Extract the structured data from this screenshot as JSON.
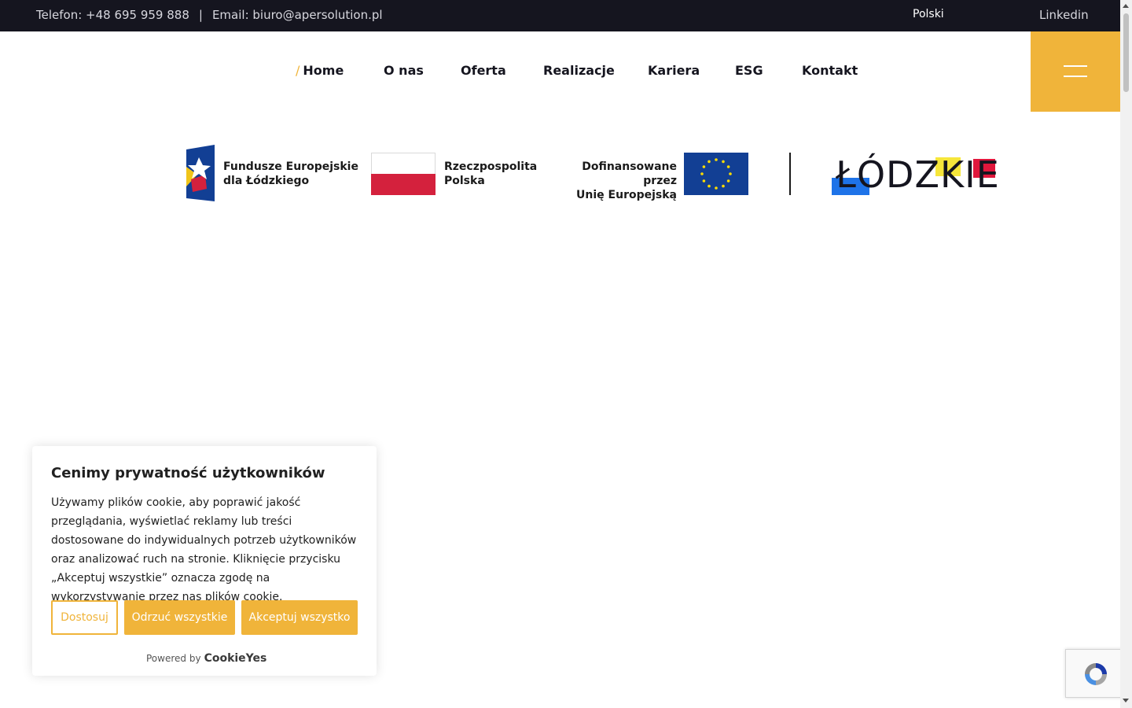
{
  "topbar": {
    "phone": "Telefon: +48 695 959 888",
    "separator": "|",
    "email": "Email: biuro@apersolution.pl",
    "language": "Polski",
    "linkedin": "Linkedin"
  },
  "nav": {
    "active_marker": "/",
    "items": [
      {
        "label": "Home"
      },
      {
        "label": "O nas"
      },
      {
        "label": "Oferta"
      },
      {
        "label": "Realizacje"
      },
      {
        "label": "Kariera"
      },
      {
        "label": "ESG"
      },
      {
        "label": "Kontakt"
      }
    ],
    "menu_icon": "hamburger-icon"
  },
  "funding": {
    "fe_line1": "Fundusze Europejskie",
    "fe_line2": "dla Łódzkiego",
    "rp_line1": "Rzeczpospolita",
    "rp_line2": "Polska",
    "ue_line1": "Dofinansowane przez",
    "ue_line2": "Unię Europejską",
    "region": "ŁÓDZKIE"
  },
  "cookie": {
    "title": "Cenimy prywatność użytkowników",
    "text": "Używamy plików cookie, aby poprawić jakość przeglądania, wyświetlać reklamy lub treści dostosowane do indywidualnych potrzeb użytkowników oraz analizować ruch na stronie. Kliknięcie przycisku „Akceptuj wszystkie” oznacza zgodę na wykorzystywanie przez nas plików cookie.",
    "customize": "Dostosuj",
    "reject": "Odrzuć wszystkie",
    "accept": "Akceptuj wszystko",
    "powered_by": "Powered by",
    "brand": "CookieYes"
  },
  "colors": {
    "accent": "#f0b43a",
    "topbar_bg": "#15151f",
    "eu_blue": "#123f94",
    "poland_red": "#d4213d"
  },
  "icons": [
    "hamburger-icon",
    "eu-flag-icon",
    "poland-flag-icon",
    "fe-logo-icon",
    "recaptcha-icon",
    "scroll-up-icon",
    "scroll-down-icon"
  ]
}
